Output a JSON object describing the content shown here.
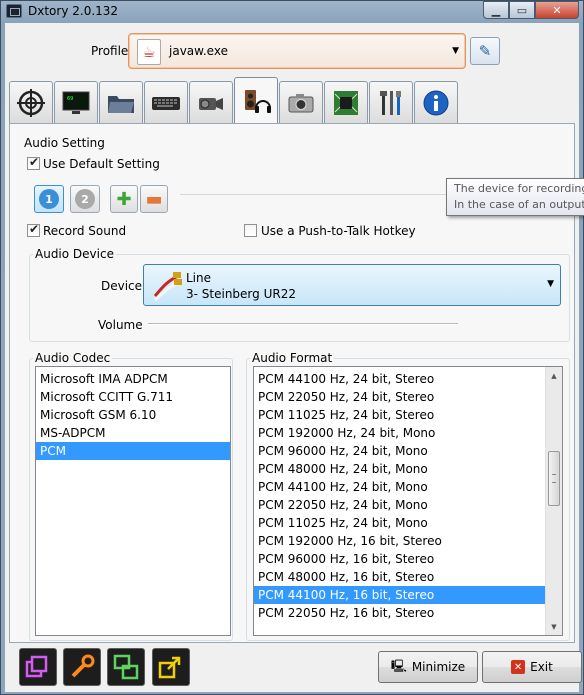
{
  "window": {
    "title": "Dxtory 2.0.132"
  },
  "profile": {
    "label": "Profile",
    "value": "javaw.exe"
  },
  "tabs": [
    {
      "name": "target",
      "icon": "crosshair-icon"
    },
    {
      "name": "display",
      "icon": "monitor-icon"
    },
    {
      "name": "folder",
      "icon": "folder-icon"
    },
    {
      "name": "hotkey",
      "icon": "keyboard-icon"
    },
    {
      "name": "movie",
      "icon": "camcorder-icon"
    },
    {
      "name": "audio",
      "icon": "speaker-headphones-icon",
      "active": true
    },
    {
      "name": "screenshot",
      "icon": "camera-icon"
    },
    {
      "name": "advanced",
      "icon": "chip-icon"
    },
    {
      "name": "tools",
      "icon": "tools-icon"
    },
    {
      "name": "info",
      "icon": "info-icon"
    }
  ],
  "audio_setting": {
    "title": "Audio Setting",
    "use_default_label": "Use Default Setting",
    "use_default_checked": true,
    "slot1": "1",
    "slot2": "2",
    "record_sound_label": "Record Sound",
    "record_sound_checked": true,
    "push_to_talk_label": "Use a Push-to-Talk Hotkey",
    "push_to_talk_checked": false
  },
  "audio_device": {
    "title": "Audio Device",
    "device_label": "Device",
    "device_line1": "Line",
    "device_line2": "3- Steinberg UR22",
    "volume_label": "Volume"
  },
  "tooltip": {
    "line1": "The device for recording.",
    "line2": "In the case of an output e"
  },
  "audio_codec": {
    "title": "Audio Codec",
    "items": [
      "Microsoft IMA ADPCM",
      "Microsoft CCITT G.711",
      "Microsoft GSM 6.10",
      "MS-ADPCM",
      "PCM"
    ],
    "selected": "PCM"
  },
  "audio_format": {
    "title": "Audio Format",
    "items": [
      "PCM 44100 Hz, 24 bit, Stereo",
      "PCM 22050 Hz, 24 bit, Stereo",
      "PCM 11025 Hz, 24 bit, Stereo",
      "PCM 192000 Hz, 24 bit, Mono",
      "PCM 96000 Hz, 24 bit, Mono",
      "PCM 48000 Hz, 24 bit, Mono",
      "PCM 44100 Hz, 24 bit, Mono",
      "PCM 22050 Hz, 24 bit, Mono",
      "PCM 11025 Hz, 24 bit, Mono",
      "PCM 192000 Hz, 16 bit, Stereo",
      "PCM 96000 Hz, 16 bit, Stereo",
      "PCM 48000 Hz, 16 bit, Stereo",
      "PCM 44100 Hz, 16 bit, Stereo",
      "PCM 22050 Hz, 16 bit, Stereo"
    ],
    "selected": "PCM 44100 Hz, 16 bit, Stereo"
  },
  "buttons": {
    "minimize": "Minimize",
    "exit": "Exit"
  },
  "colors": {
    "accent_selection": "#3399ff",
    "slot1": "#3b8fd8",
    "slot2": "#a9a9a9",
    "add": "#3aa53a",
    "remove": "#e6753a"
  }
}
